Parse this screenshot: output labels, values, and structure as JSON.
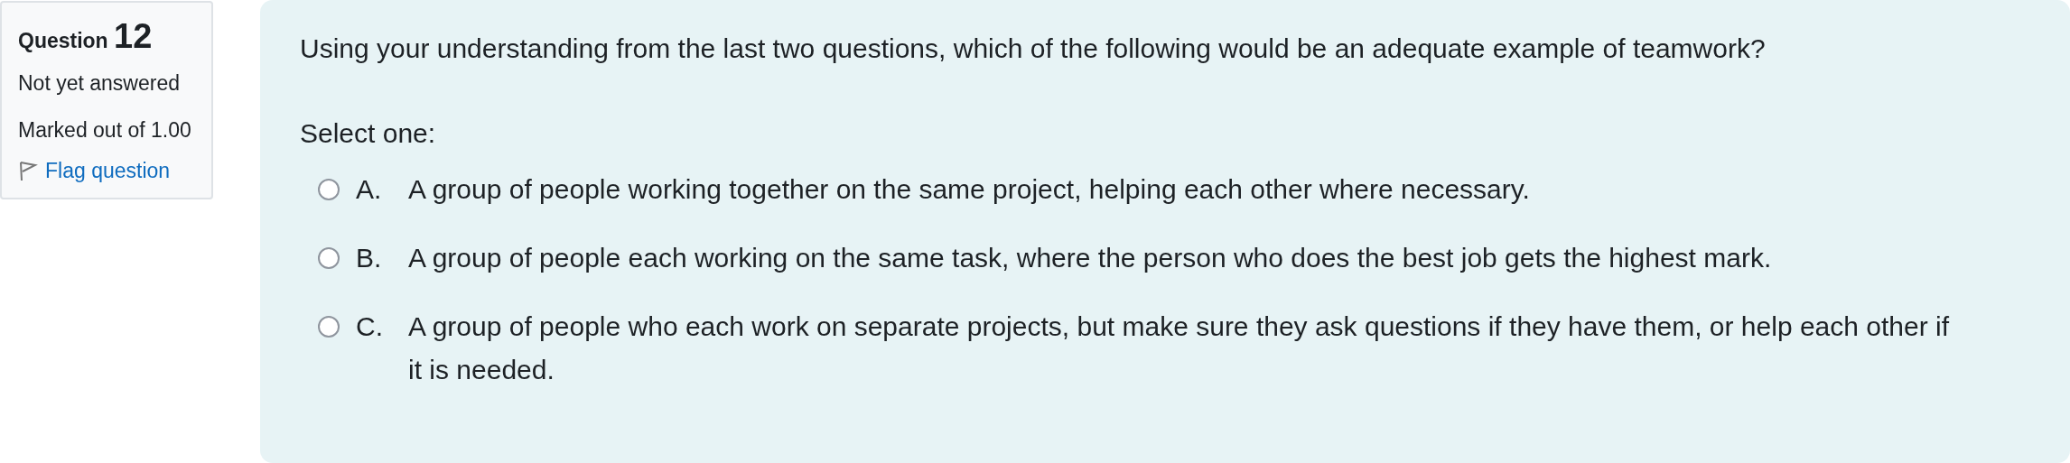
{
  "info": {
    "label": "Question",
    "number": "12",
    "state": "Not yet answered",
    "grade": "Marked out of 1.00",
    "flag": {
      "label": "Flag question",
      "flagged": false
    }
  },
  "question": {
    "text": "Using your understanding from the last two questions, which of the following would be an adequate example of teamwork?",
    "prompt": "Select one:",
    "options": [
      {
        "letter": "A.",
        "text": "A group of people working together on the same project, helping each other where necessary.",
        "selected": false
      },
      {
        "letter": "B.",
        "text": "A group of people each working on the same task, where the person who does the best job gets the highest mark.",
        "selected": false
      },
      {
        "letter": "C.",
        "text": "A group of people who each work on separate projects, but make sure they ask questions if they have them, or help each other if it is needed.",
        "selected": false
      }
    ]
  }
}
